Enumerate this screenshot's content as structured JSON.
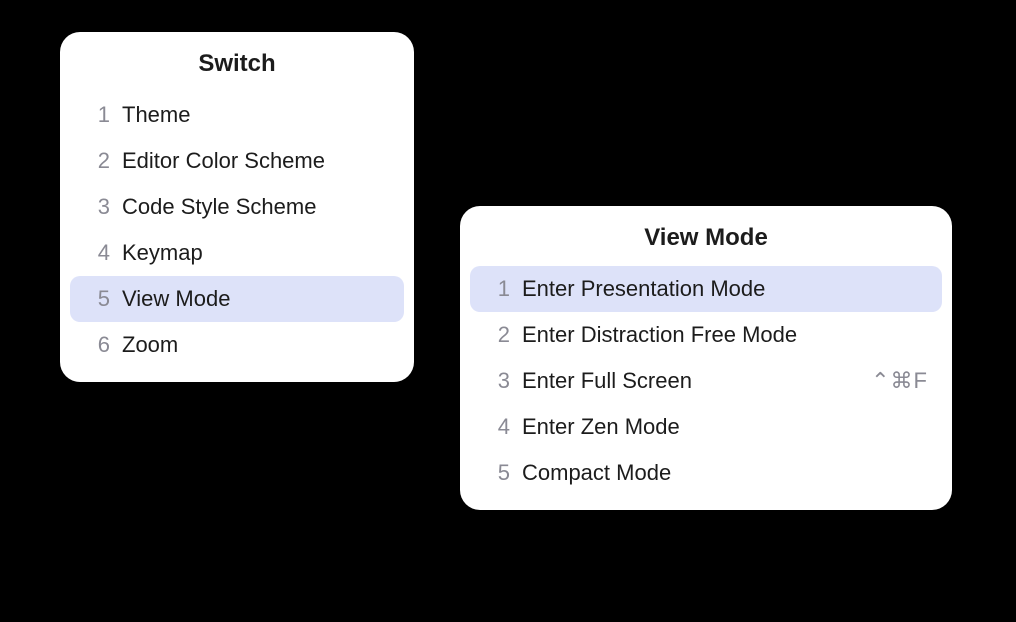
{
  "switch_popup": {
    "title": "Switch",
    "items": [
      {
        "num": "1",
        "label": "Theme",
        "selected": false
      },
      {
        "num": "2",
        "label": "Editor Color Scheme",
        "selected": false
      },
      {
        "num": "3",
        "label": "Code Style Scheme",
        "selected": false
      },
      {
        "num": "4",
        "label": "Keymap",
        "selected": false
      },
      {
        "num": "5",
        "label": "View Mode",
        "selected": true
      },
      {
        "num": "6",
        "label": "Zoom",
        "selected": false
      }
    ]
  },
  "viewmode_popup": {
    "title": "View Mode",
    "items": [
      {
        "num": "1",
        "label": "Enter Presentation Mode",
        "selected": true
      },
      {
        "num": "2",
        "label": "Enter Distraction Free Mode",
        "selected": false
      },
      {
        "num": "3",
        "label": "Enter Full Screen",
        "shortcut": "⌃⌘F",
        "selected": false
      },
      {
        "num": "4",
        "label": "Enter Zen Mode",
        "selected": false
      },
      {
        "num": "5",
        "label": "Compact Mode",
        "selected": false
      }
    ]
  }
}
